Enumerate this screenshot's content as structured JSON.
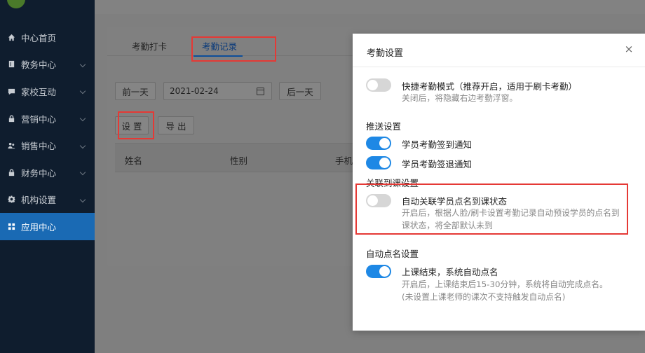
{
  "sidebar": {
    "items": [
      {
        "label": "中心首页",
        "icon": "home-icon",
        "active": false,
        "has_chevron": false
      },
      {
        "label": "教务中心",
        "icon": "book-icon",
        "active": false,
        "has_chevron": true
      },
      {
        "label": "家校互动",
        "icon": "chat-icon",
        "active": false,
        "has_chevron": true
      },
      {
        "label": "营销中心",
        "icon": "lock-icon",
        "active": false,
        "has_chevron": true
      },
      {
        "label": "销售中心",
        "icon": "users-icon",
        "active": false,
        "has_chevron": true
      },
      {
        "label": "财务中心",
        "icon": "lock-icon",
        "active": false,
        "has_chevron": true
      },
      {
        "label": "机构设置",
        "icon": "gear-icon",
        "active": false,
        "has_chevron": true
      },
      {
        "label": "应用中心",
        "icon": "grid-icon",
        "active": true,
        "has_chevron": false
      }
    ]
  },
  "main": {
    "tabs": [
      {
        "label": "考勤打卡",
        "active": false
      },
      {
        "label": "考勤记录",
        "active": true
      }
    ],
    "toolbar": {
      "prev_day": "前一天",
      "date": "2021-02-24",
      "next_day": "后一天",
      "settings": "设 置",
      "export": "导 出"
    },
    "table": {
      "columns": [
        "姓名",
        "性别",
        "手机"
      ]
    }
  },
  "modal": {
    "title": "考勤设置",
    "close_glyph": "×",
    "quick_mode": {
      "label": "快捷考勤模式（推荐开启，适用于刷卡考勤）",
      "desc": "关闭后，将隐藏右边考勤浮窗。",
      "enabled": false
    },
    "push_section": {
      "title": "推送设置",
      "sign_in": {
        "label": "学员考勤签到通知",
        "enabled": true
      },
      "sign_out": {
        "label": "学员考勤签退通知",
        "enabled": true
      }
    },
    "link_section": {
      "title": "关联到课设置",
      "auto_link": {
        "label": "自动关联学员点名到课状态",
        "desc_line1": "开启后，根据人脸/刷卡设置考勤记录自动预设学员的点名到",
        "desc_line2": "课状态，将全部默认未到",
        "enabled": false
      }
    },
    "rollcall_section": {
      "title": "自动点名设置",
      "auto_rollcall": {
        "label": "上课结束，系统自动点名",
        "desc_line1": "开启后，上课结束后15-30分钟，系统将自动完成点名。",
        "desc_line2": "(未设置上课老师的课次不支持触发自动点名)",
        "enabled": true
      }
    }
  },
  "colors": {
    "sidebar_bg": "#0f1d2e",
    "active_nav": "#1a6ab4",
    "toggle_on": "#1e88e5",
    "toggle_off": "#d6d6d6",
    "highlight": "#e53935"
  }
}
